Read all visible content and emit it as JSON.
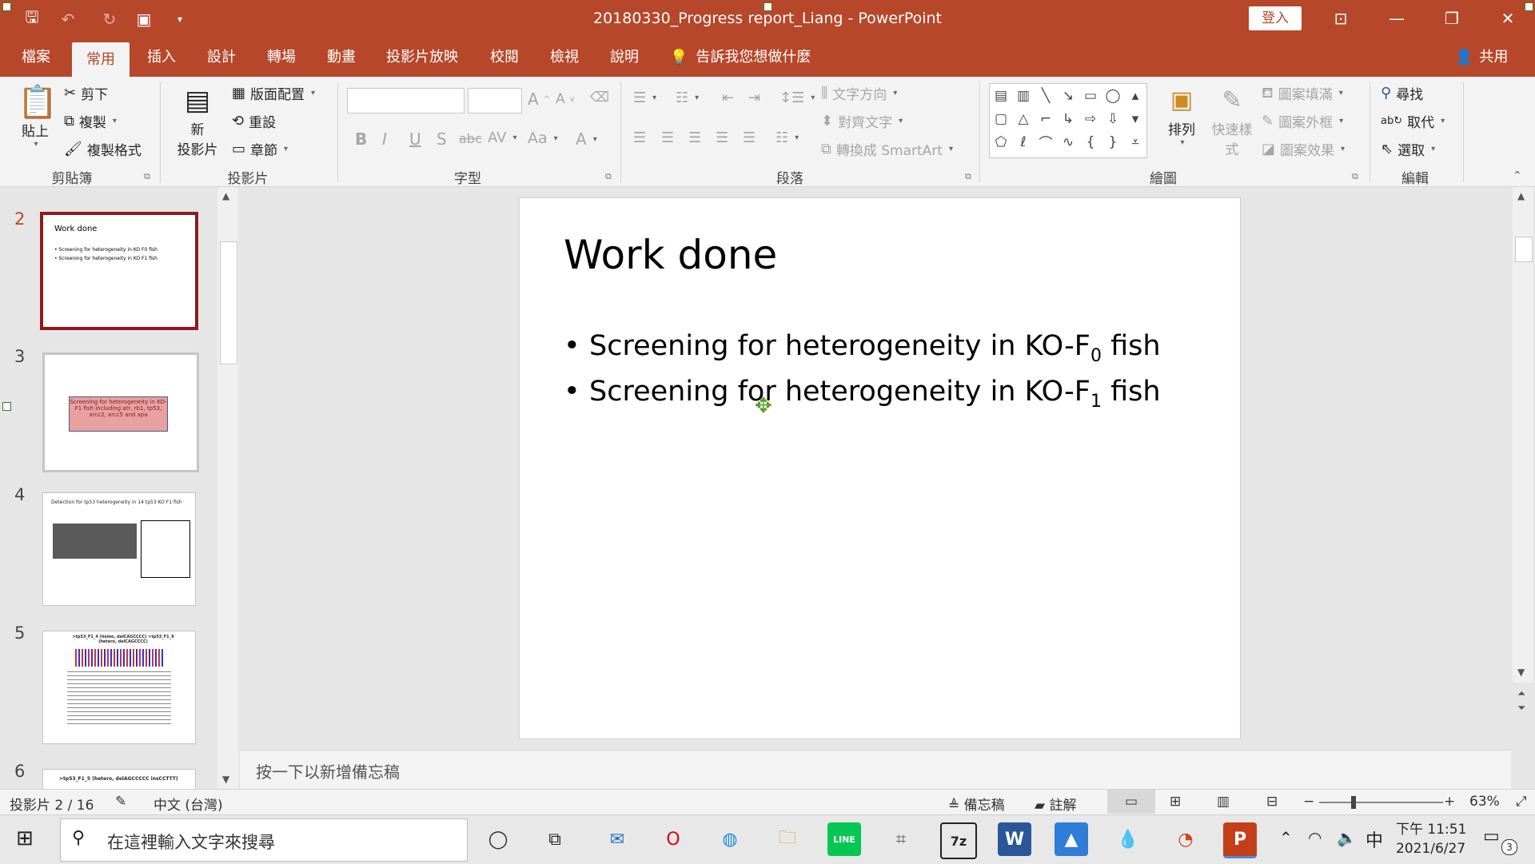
{
  "window": {
    "title": "20180330_Progress report_Liang  -  PowerPoint",
    "signin_label": "登入"
  },
  "tabs": [
    "檔案",
    "常用",
    "插入",
    "設計",
    "轉場",
    "動畫",
    "投影片放映",
    "校閱",
    "檢視",
    "說明"
  ],
  "active_tab": "常用",
  "tell_me": "告訴我您想做什麼",
  "share_label": "共用",
  "ribbon": {
    "clipboard": {
      "paste": "貼上",
      "cut": "剪下",
      "copy": "複製",
      "format_painter": "複製格式",
      "label": "剪貼簿"
    },
    "slides": {
      "new_line1": "新",
      "new_line2": "投影片",
      "layout": "版面配置",
      "reset": "重設",
      "section": "章節",
      "label": "投影片"
    },
    "font": {
      "label": "字型",
      "bold": "B",
      "italic": "I",
      "underline": "U",
      "shadow": "S",
      "strike": "abc",
      "spacing": "AV",
      "case": "Aa",
      "color": "A"
    },
    "paragraph": {
      "label": "段落",
      "text_direction": "文字方向",
      "align_text": "對齊文字",
      "smartart": "轉換成 SmartArt"
    },
    "drawing": {
      "label": "繪圖",
      "arrange": "排列",
      "quick_styles_line1": "快速樣",
      "quick_styles_line2": "式",
      "shape_fill": "圖案填滿",
      "shape_outline": "圖案外框",
      "shape_effects": "圖案效果"
    },
    "editing": {
      "label": "編輯",
      "find": "尋找",
      "replace": "取代",
      "select": "選取"
    }
  },
  "thumbnails": [
    {
      "num": "2",
      "title": "Work done",
      "bullets": [
        "Screening for heterogeneity in KO F0 fish",
        "Screening for heterogeneity in KO F1 fish"
      ]
    },
    {
      "num": "3",
      "box_text": "Screening for heterogeneity in KO-F1 fish including atr, rb1, tp53, xrcc2, xrcc5 and xpa"
    },
    {
      "num": "4",
      "title": "Detection for tp53 heterogeneity in 14 tp53 KO F1 fish"
    },
    {
      "num": "5",
      "title": ">tp53_F1_4 (homo, delCAGCCCC) >tp53_F1_9 (hetero, delCAGCCCC)"
    },
    {
      "num": "6",
      "title": ">tp53_F1_5 (hetero, delAGCCCCC insCCTTT)"
    }
  ],
  "slide": {
    "title": "Work done",
    "bullets": [
      {
        "text": "Screening for heterogeneity in KO-F",
        "sub": "0",
        "tail": " fish"
      },
      {
        "text": "Screening for heterogeneity in KO-F",
        "sub": "1",
        "tail": " fish"
      }
    ]
  },
  "notes_placeholder": "按一下以新增備忘稿",
  "status": {
    "slide_counter": "投影片 2 / 16",
    "language": "中文 (台灣)",
    "notes": "備忘稿",
    "comments": "註解",
    "zoom": "63%"
  },
  "taskbar": {
    "search_placeholder": "在這裡輸入文字來搜尋",
    "ime": "中",
    "time": "下午 11:51",
    "date": "2021/6/27",
    "notification_count": "3"
  },
  "colors": {
    "accent": "#b7472a",
    "selected_thumb": "#8e1c1c",
    "slide3_box": "#e8a0a0"
  }
}
